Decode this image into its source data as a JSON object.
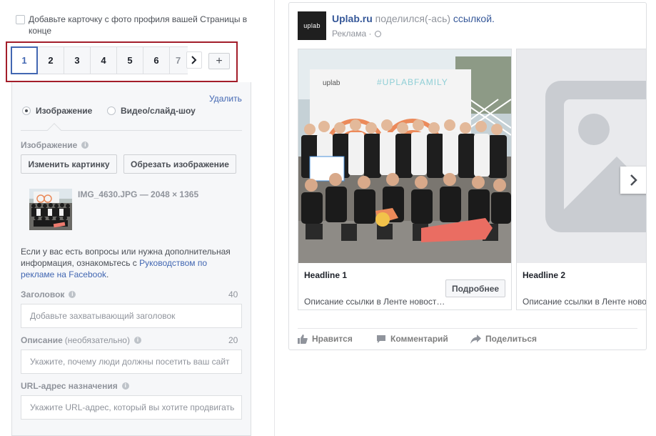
{
  "editor": {
    "end_card_checkbox": {
      "label": "Добавьте карточку с фото профиля вашей Страницы в конце",
      "checked": false
    },
    "cards": {
      "tabs": [
        "1",
        "2",
        "3",
        "4",
        "5",
        "6",
        "7"
      ],
      "active": "1",
      "next_icon": "chevron-right-icon",
      "add_label": "+"
    },
    "remove_link": "Удалить",
    "media_type": {
      "options": [
        "Изображение",
        "Видео/слайд-шоу"
      ],
      "selected": "Изображение"
    },
    "image_section": {
      "label": "Изображение",
      "change_button": "Изменить картинку",
      "crop_button": "Обрезать изображение",
      "file_name": "IMG_4630.JPG — 2048 × 1365"
    },
    "help": {
      "text_before": "Если у вас есть вопросы или нужна дополнительная информация, ознакомьтесь с ",
      "link_text": "Руководством по рекламе на Facebook",
      "text_after": "."
    },
    "headline": {
      "label": "Заголовок",
      "counter": "40",
      "placeholder": "Добавьте захватывающий заголовок"
    },
    "description": {
      "label": "Описание",
      "optional": "(необязательно)",
      "counter": "20",
      "placeholder": "Укажите, почему люди должны посетить ваш сайт"
    },
    "url": {
      "label": "URL-адрес назначения",
      "placeholder": "Укажите URL-адрес, который вы хотите продвигать"
    }
  },
  "preview": {
    "page_logo_text": "uplab",
    "page_name": "Uplab.ru",
    "shared_text": "поделился(-ась)",
    "link_word": "ссылкой.",
    "sponsored": "Реклама ·",
    "cards": [
      {
        "headline": "Headline 1",
        "description": "Описание ссылки в Ленте новост…",
        "cta": "Подробнее",
        "image_banner_text": "#UPLABFAMILY",
        "image_logo_text": "uplab"
      },
      {
        "headline": "Headline 2",
        "description": "Описание ссылки в Ленте новост…"
      }
    ],
    "actions": [
      {
        "label": "Нравится",
        "icon": "like-icon"
      },
      {
        "label": "Комментарий",
        "icon": "comment-icon"
      },
      {
        "label": "Поделиться",
        "icon": "share-icon"
      }
    ]
  },
  "colors": {
    "accent": "#4267b2",
    "link": "#365899",
    "highlight_border": "#a31d2a",
    "panel_bg": "#f6f7f9"
  }
}
